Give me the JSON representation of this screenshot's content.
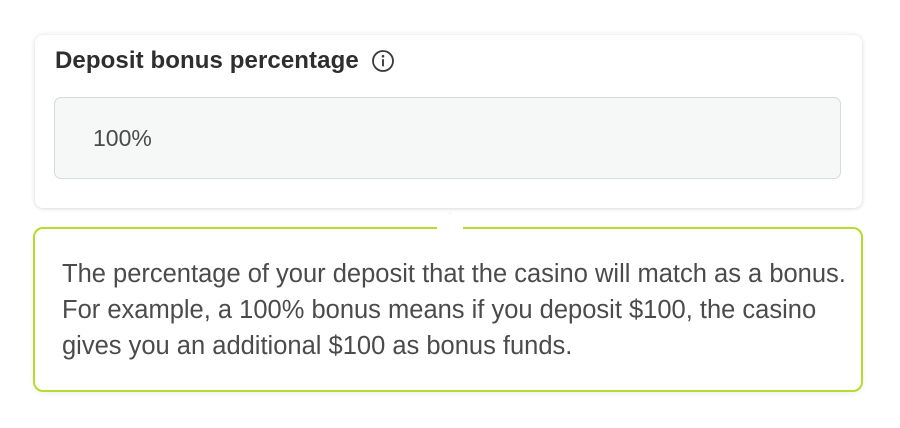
{
  "field": {
    "label": "Deposit bonus percentage",
    "info_icon": "info-icon",
    "value": "100%",
    "placeholder": ""
  },
  "tooltip": {
    "text": "The percentage of your deposit that the casino will match as a bonus. For example, a 100% bonus means if you deposit $100, the casino gives you an additional $100 as bonus funds.",
    "border_color": "#b6dd2c"
  }
}
